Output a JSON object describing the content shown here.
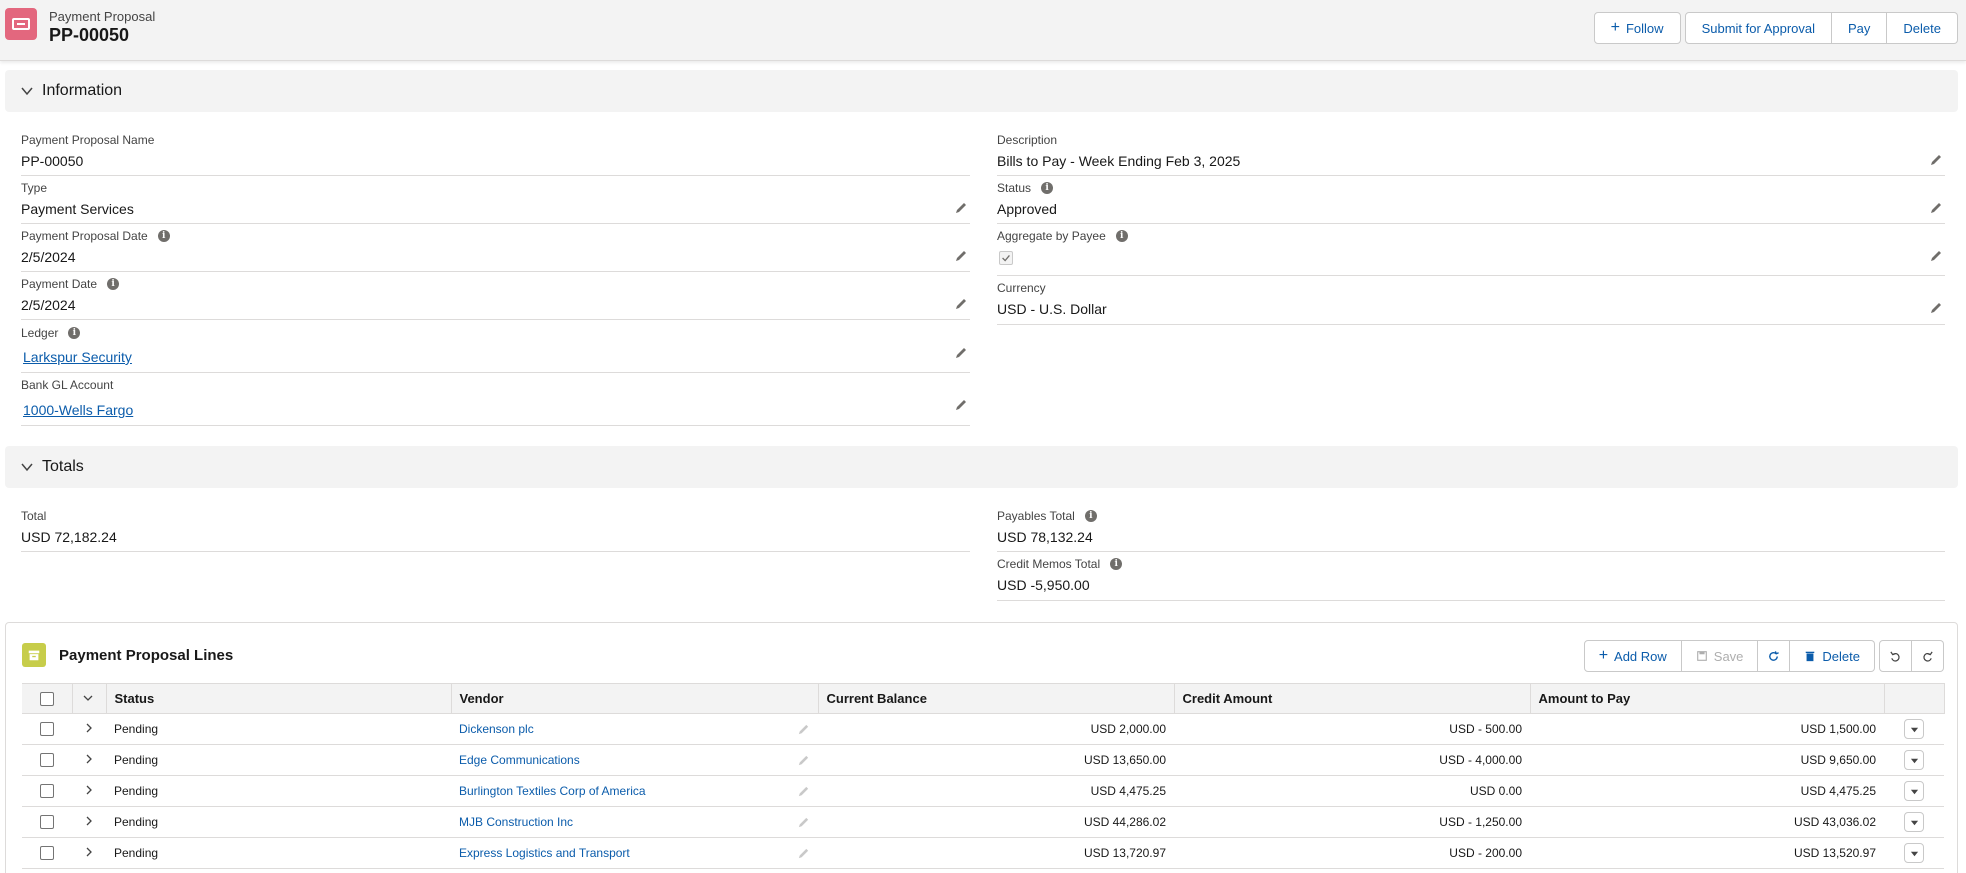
{
  "header": {
    "object_type": "Payment Proposal",
    "record_name": "PP-00050",
    "icon": "payment-proposal-icon",
    "actions": {
      "follow": "Follow",
      "submit": "Submit for Approval",
      "pay": "Pay",
      "delete": "Delete"
    }
  },
  "information": {
    "title": "Information",
    "left": [
      {
        "label": "Payment Proposal Name",
        "value": "PP-00050"
      },
      {
        "label": "Type",
        "value": "Payment Services"
      },
      {
        "label": "Payment Proposal Date",
        "value": "2/5/2024"
      },
      {
        "label": "Payment Date",
        "value": "2/5/2024"
      },
      {
        "label": "Ledger",
        "value": "Larkspur Security"
      },
      {
        "label": "Bank GL Account",
        "value": "1000-Wells Fargo"
      }
    ],
    "right": [
      {
        "label": "Description",
        "value": "Bills to Pay - Week Ending Feb 3, 2025"
      },
      {
        "label": "Status",
        "value": "Approved"
      },
      {
        "label": "Aggregate by Payee",
        "value": true
      },
      {
        "label": "Currency",
        "value": "USD - U.S. Dollar"
      }
    ]
  },
  "totals": {
    "title": "Totals",
    "total": {
      "label": "Total",
      "value": "USD 72,182.24"
    },
    "payables_total": {
      "label": "Payables Total",
      "value": "USD 78,132.24"
    },
    "credit_memos_total": {
      "label": "Credit Memos Total",
      "value": "USD -5,950.00"
    }
  },
  "lines": {
    "title": "Payment Proposal Lines",
    "actions": {
      "add_row": "Add Row",
      "save": "Save",
      "delete": "Delete"
    },
    "columns": [
      "Status",
      "Vendor",
      "Current Balance",
      "Credit Amount",
      "Amount to Pay"
    ],
    "rows": [
      {
        "status": "Pending",
        "vendor": "Dickenson plc",
        "current_balance": "USD 2,000.00",
        "credit_amount": "USD - 500.00",
        "amount_to_pay": "USD 1,500.00"
      },
      {
        "status": "Pending",
        "vendor": "Edge Communications",
        "current_balance": "USD 13,650.00",
        "credit_amount": "USD - 4,000.00",
        "amount_to_pay": "USD 9,650.00"
      },
      {
        "status": "Pending",
        "vendor": "Burlington Textiles Corp of America",
        "current_balance": "USD 4,475.25",
        "credit_amount": "USD 0.00",
        "amount_to_pay": "USD 4,475.25"
      },
      {
        "status": "Pending",
        "vendor": "MJB Construction Inc",
        "current_balance": "USD 44,286.02",
        "credit_amount": "USD - 1,250.00",
        "amount_to_pay": "USD 43,036.02"
      },
      {
        "status": "Pending",
        "vendor": "Express Logistics and Transport",
        "current_balance": "USD 13,720.97",
        "credit_amount": "USD - 200.00",
        "amount_to_pay": "USD 13,520.97"
      }
    ]
  },
  "colors": {
    "brand_link": "#0b5cab",
    "object_icon": "#e3677e",
    "lines_icon": "#c7cd4a"
  }
}
